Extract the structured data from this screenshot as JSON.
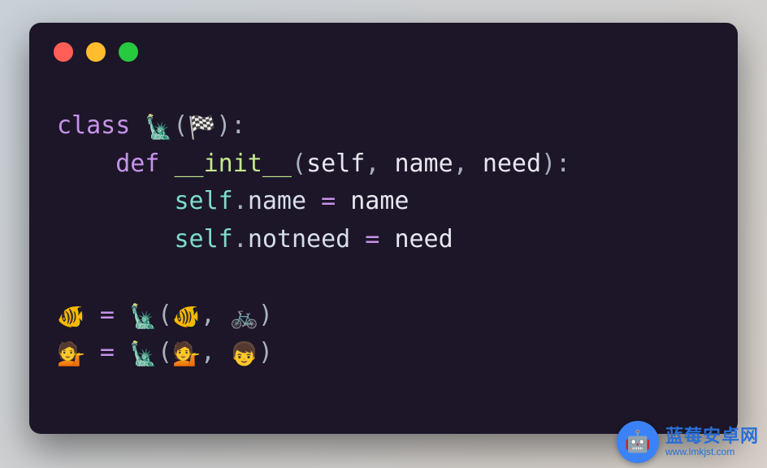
{
  "code": {
    "line1": {
      "kw_class": "class",
      "class_emoji": "🗽",
      "parent_emoji": "🏁",
      "open": "(",
      "close": "):"
    },
    "line2": {
      "kw_def": "def",
      "fn_name": "__init__",
      "params_open": "(",
      "p_self": "self",
      "c1": ", ",
      "p_name": "name",
      "c2": ", ",
      "p_need": "need",
      "params_close": "):"
    },
    "line3": {
      "self": "self",
      "dot": ".",
      "attr": "name",
      "eq": " = ",
      "val": "name"
    },
    "line4": {
      "self": "self",
      "dot": ".",
      "attr": "notneed",
      "eq": " = ",
      "val": "need"
    },
    "line6": {
      "lhs_emoji": "🐠",
      "eq": " = ",
      "cls_emoji": "🗽",
      "open": "(",
      "arg1_emoji": "🐠",
      "c": ", ",
      "arg2_emoji": "🚲",
      "close": ")"
    },
    "line7": {
      "lhs_emoji": "💁",
      "eq": " = ",
      "cls_emoji": "🗽",
      "open": "(",
      "arg1_emoji": "💁",
      "c": ", ",
      "arg2_emoji": "👦",
      "close": ")"
    }
  },
  "watermark": {
    "title": "蓝莓安卓网",
    "subtitle": "www.lmkjst.com",
    "icon_glyph": "🤖"
  }
}
